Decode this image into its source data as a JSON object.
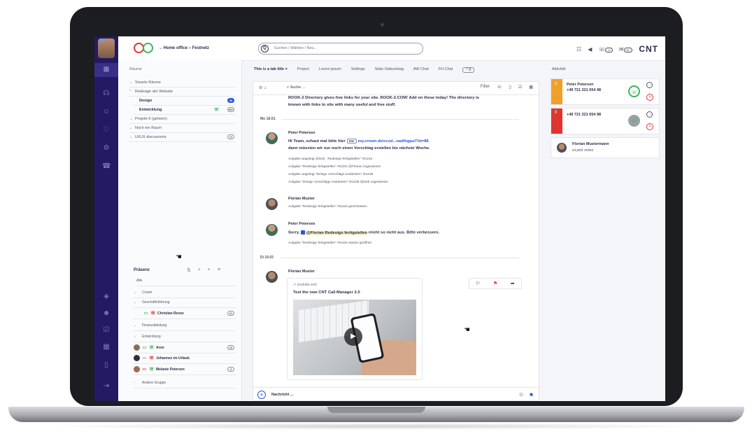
{
  "top": {
    "mode": "Home office – Festnetz",
    "search_placeholder": "Suchen / Wählen / Neu...",
    "brand": "CNT",
    "badge_small": "12",
    "badge_big": "99+"
  },
  "rooms": {
    "title": "Räume",
    "items": [
      {
        "label": "Smarte Räume"
      },
      {
        "label": "Redesign der Website"
      },
      {
        "label": "Design",
        "badge": "10"
      },
      {
        "label": "Entwicklung",
        "badge": "99+"
      },
      {
        "label": "Projekt-X (geheim)"
      },
      {
        "label": "Noch ein Raum"
      },
      {
        "label": "UI/UX discussions",
        "badge": "99"
      }
    ]
  },
  "presence": {
    "title": "Präsenz",
    "items": [
      {
        "label": "Alle"
      },
      {
        "label": "Crown"
      },
      {
        "label": "Geschäftsführung"
      },
      {
        "label": "Christian Renze",
        "badge": "21"
      },
      {
        "label": "Finanzabteilung"
      },
      {
        "label": "Entwicklung"
      },
      {
        "label": "Aron",
        "badge": "10"
      },
      {
        "label": "Johannes im Urlaub"
      },
      {
        "label": "Melanie Petersen",
        "badge": "3"
      },
      {
        "label": "Andere Gruppe"
      }
    ]
  },
  "tabs": [
    "This is a tab title",
    "Project",
    "Lorem ipsum",
    "Settings",
    "Sebs Geburtstag",
    "AW Chat",
    "FH Chat"
  ],
  "tab_more": "^ 8",
  "chat": {
    "search": "Suche ...",
    "filter": "Filter",
    "intro_1": "ROOK-2 Directory gives free links for your site. ROOK-2.COM! Add on these today! The directory is",
    "intro_2": "known with links to site with many useful and free stuff.",
    "date_1": "Mo 18.03.",
    "m1_name": "Peter Petersen",
    "m1_a": "Hi Team, schaut mal bitte hier",
    "m1_pdf": "PDF",
    "m1_link": "my.crown.de/ccsd...oad/hgpul?id=88",
    "m1_b": "dann müssten wir nur noch einen Vorschlag erstellen bis nächste Woche.",
    "m1_sys": [
      "Aufgabe angelegt @Seb , Redesign fertigstellen\" #t1234",
      "Aufgabe \"Redesign fertigstellen\" #t1234 @Florian zugewiesen",
      "Aufgabe angelegt \"Design Vorschläge erarbeiten\" #t1235",
      "Aufgabe \"Design Vorschläge erarbeiten\" #t1235 @Seb zugewiesen"
    ],
    "m2_name": "Florian Muster",
    "m2_sys": "Aufgabe \"Redesign fertigstellen\" #t1234 geschlossen",
    "m3_name": "Peter Petersen",
    "m3_a": "Sorry,",
    "m3_mention": "@Florian Redesign fertigstellen",
    "m3_b": "reicht so nicht aus. Bitte verbessern.",
    "m3_sys": "Aufgabe \"Redesign fertigstellen\" #t1234 wieder geöffnet",
    "date_2": "Di 19.03",
    "m4_name": "Florian Muster",
    "card_src": "youtube.com",
    "card_title": "Test the new CNT Call Manager 2.0",
    "composer": "Nachricht ..."
  },
  "activity": {
    "title": "Aktivität",
    "call1_name": "Peter Petersen",
    "call1_num": "+49 721 321 654 98",
    "call2_num": "+49 721 321 654 98",
    "online_name": "Florian Mustermann",
    "online_status": "ist jetzt online"
  },
  "colors": {
    "rail": "#241a63",
    "accent": "#2f55d4",
    "call_orange": "#f0a02a",
    "call_red": "#e0342f",
    "green": "#3cb55a"
  }
}
